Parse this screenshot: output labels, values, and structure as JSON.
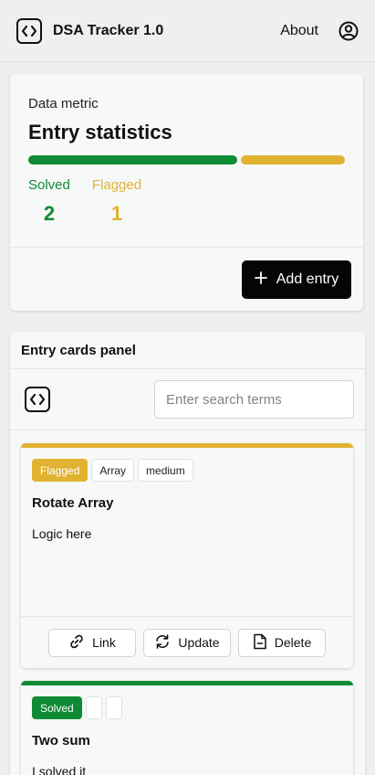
{
  "header": {
    "app_title": "DSA Tracker 1.0",
    "about_label": "About",
    "logo_icon": "code-brackets-icon",
    "profile_icon": "user-circle-icon"
  },
  "stats": {
    "subtitle": "Data metric",
    "title": "Entry statistics",
    "solved_label": "Solved",
    "solved_value": "2",
    "flagged_label": "Flagged",
    "flagged_value": "1",
    "solved_fraction": 0.667,
    "flagged_fraction": 0.333,
    "add_label": "Add entry",
    "colors": {
      "solved": "#0f8b35",
      "flagged": "#e1b22f"
    }
  },
  "panel": {
    "title": "Entry cards panel",
    "search_placeholder": "Enter search terms",
    "tool_icon": "code-brackets-icon"
  },
  "cards": [
    {
      "status": "Flagged",
      "tags": [
        "Array",
        "medium"
      ],
      "title": "Rotate Array",
      "text": "Logic here",
      "actions": {
        "link": "Link",
        "update": "Update",
        "delete": "Delete"
      }
    },
    {
      "status": "Solved",
      "tags": [
        "",
        ""
      ],
      "title": "Two sum",
      "text": "I solved it"
    }
  ]
}
